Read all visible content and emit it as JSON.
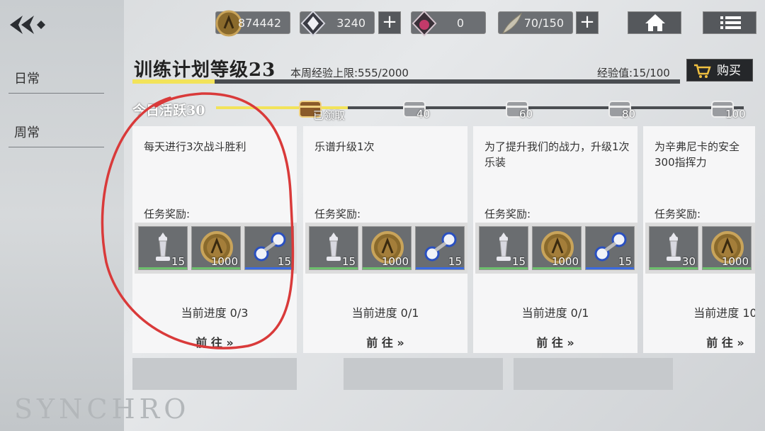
{
  "sidebar": {
    "tabs": [
      {
        "label": "日常"
      },
      {
        "label": "周常"
      }
    ],
    "watermark": "SYNCHRO"
  },
  "resources": [
    {
      "icon": "coin-icon",
      "value": "874442"
    },
    {
      "icon": "crystal-icon",
      "value": "3240"
    },
    {
      "icon": "red-gem-icon",
      "value": "0"
    },
    {
      "icon": "stamina-icon",
      "value": "70/150"
    }
  ],
  "header": {
    "title": "训练计划等级23",
    "week_limit": "本周经验上限:555/2000",
    "exp": "经验值:15/100",
    "buy_label": "购买",
    "progress_fraction": 0.15
  },
  "activity": {
    "label": "今日活跃30",
    "fill_fraction": 0.25,
    "milestones": [
      {
        "label": "已领取"
      },
      {
        "label": "40"
      },
      {
        "label": "60"
      },
      {
        "label": "80"
      },
      {
        "label": "100"
      }
    ]
  },
  "reward_label": "任务奖励:",
  "go_label": "前 往 »",
  "tasks": [
    {
      "desc": "每天进行3次战斗胜利",
      "progress": "当前进度 0/3",
      "rewards": [
        {
          "icon": "chess-icon",
          "qty": "15"
        },
        {
          "icon": "coin-icon",
          "qty": "1000"
        },
        {
          "icon": "dumbbell-icon",
          "qty": "15"
        }
      ]
    },
    {
      "desc": "乐谱升级1次",
      "progress": "当前进度 0/1",
      "rewards": [
        {
          "icon": "chess-icon",
          "qty": "15"
        },
        {
          "icon": "coin-icon",
          "qty": "1000"
        },
        {
          "icon": "dumbbell-icon",
          "qty": "15"
        }
      ]
    },
    {
      "desc": "为了提升我们的战力，升级1次乐装",
      "progress": "当前进度 0/1",
      "rewards": [
        {
          "icon": "chess-icon",
          "qty": "15"
        },
        {
          "icon": "coin-icon",
          "qty": "1000"
        },
        {
          "icon": "dumbbell-icon",
          "qty": "15"
        }
      ]
    },
    {
      "desc": "为辛弗尼卡的安全300指挥力",
      "progress": "当前进度 10",
      "rewards": [
        {
          "icon": "chess-icon",
          "qty": "30"
        },
        {
          "icon": "coin-icon",
          "qty": "1000"
        }
      ]
    }
  ]
}
